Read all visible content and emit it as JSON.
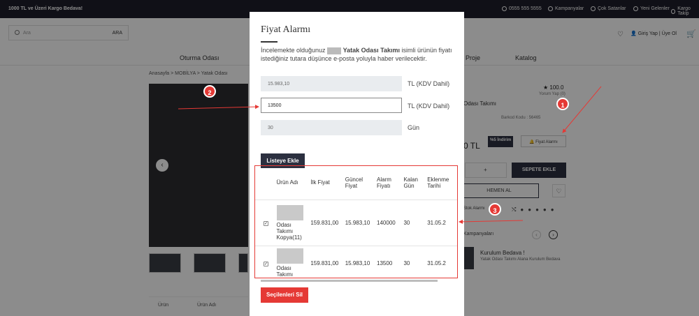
{
  "topbar": {
    "promo": "1000 TL ve Üzeri  Kargo Bedava!",
    "links": [
      "0555 555 5555",
      "Kampanyalar",
      "Çok Satanlar",
      "Yeni Gelenler",
      "Kargo Takip"
    ]
  },
  "header": {
    "search_placeholder": "Ara",
    "search_button": "ARA",
    "login_label": "Giriş Yap | Üye Ol"
  },
  "nav": [
    "Oturma Odası",
    "Proje",
    "Katalog"
  ],
  "breadcrumb": "Anasayfa > MOBİLYA > Yatak Odası",
  "background_product": {
    "rating": "100.0",
    "rating_sub": "Yorum Yap (0)",
    "title_fragment": "Odası Takımı",
    "barcode": "Barkod Kodu : 56465",
    "price_fragment": "0 TL",
    "discount": "%5 İndirim",
    "alarm_button": "Fiyat Alarmı",
    "cart_button": "SEPETE EKLE",
    "buy_now": "HEMEN AL",
    "stock_alarm": "Stok Alarmı",
    "campaigns_title": "Kampanyaları",
    "campaign_title": "Kurulum Bedava !",
    "campaign_text": "Yatak Odası Takımı Alana Kurulum Bedava",
    "tabs": [
      "Ürün",
      "Ürün Adı"
    ]
  },
  "modal": {
    "title": "Fiyat Alarmı",
    "desc_pre": "İncelemekte olduğunuz",
    "desc_bold": "Yatak Odası Takımı",
    "desc_post": "isimli ürünün fiyatı istediğiniz tutara düşünce e-posta yoluyla haber verilecektir.",
    "current_price": "15.983,10",
    "current_price_suffix": "TL (KDV Dahil)",
    "alarm_price": "13500",
    "alarm_price_suffix": "TL (KDV Dahil)",
    "days": "30",
    "days_suffix": "Gün",
    "add_button": "Listeye Ekle",
    "delete_button": "Seçilenleri Sil",
    "table": {
      "headers": [
        "Ürün Adı",
        "İlk Fiyat",
        "Güncel Fiyat",
        "Alarm Fiyatı",
        "Kalan Gün",
        "Eklenme Tarihi"
      ],
      "rows": [
        {
          "name": "Odası Takımı Kopya(11)",
          "first": "159.831,00",
          "current": "15.983,10",
          "alarm": "140000",
          "days": "30",
          "date": "31.05.2"
        },
        {
          "name": "Odası Takımı",
          "first": "159.831,00",
          "current": "15.983,10",
          "alarm": "13500",
          "days": "30",
          "date": "31.05.2"
        }
      ]
    }
  },
  "annotations": [
    "1",
    "2",
    "3"
  ],
  "colors": {
    "accent": "#e53935",
    "dark": "#2c3040",
    "topbar": "#1e1e2a"
  }
}
